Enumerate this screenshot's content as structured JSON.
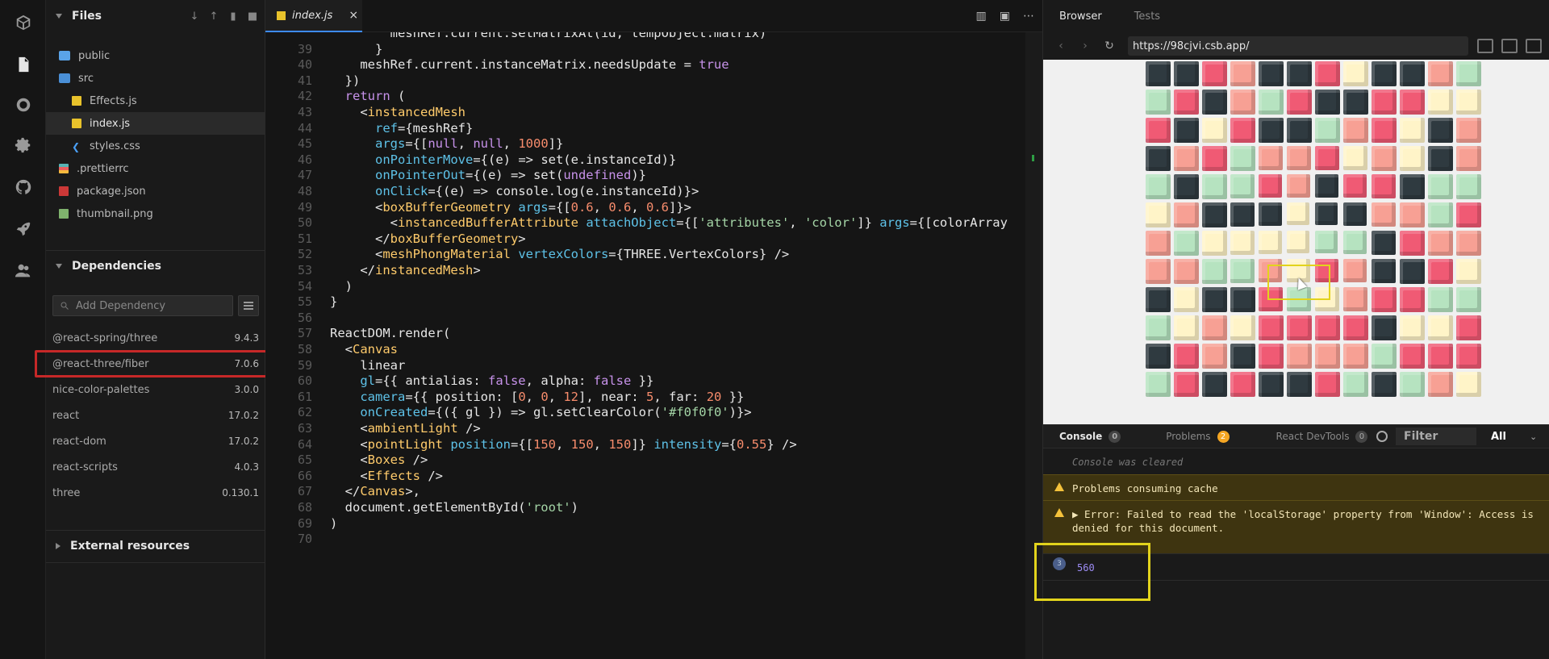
{
  "sidebar": {
    "files_title": "Files",
    "files": [
      {
        "name": "public",
        "type": "folder"
      },
      {
        "name": "src",
        "type": "folder-open"
      },
      {
        "name": "Effects.js",
        "type": "js"
      },
      {
        "name": "index.js",
        "type": "js",
        "active": true
      },
      {
        "name": "styles.css",
        "type": "css"
      },
      {
        "name": ".prettierrc",
        "type": "prettier"
      },
      {
        "name": "package.json",
        "type": "pkg"
      },
      {
        "name": "thumbnail.png",
        "type": "img"
      }
    ],
    "deps_title": "Dependencies",
    "dep_placeholder": "Add Dependency",
    "deps": [
      {
        "name": "@react-spring/three",
        "version": "9.4.3"
      },
      {
        "name": "@react-three/fiber",
        "version": "7.0.6"
      },
      {
        "name": "nice-color-palettes",
        "version": "3.0.0"
      },
      {
        "name": "react",
        "version": "17.0.2"
      },
      {
        "name": "react-dom",
        "version": "17.0.2"
      },
      {
        "name": "react-scripts",
        "version": "4.0.3"
      },
      {
        "name": "three",
        "version": "0.130.1"
      }
    ],
    "external_title": "External resources"
  },
  "editor": {
    "tab_label": "index.js",
    "close_glyph": "×",
    "lines": [
      {
        "n": "",
        "t": "        meshRef.current.setMatrixAt(id, tempObject.matrix)"
      },
      {
        "n": "39",
        "t": "      }"
      },
      {
        "n": "40",
        "t": "    meshRef.current.instanceMatrix.needsUpdate = true"
      },
      {
        "n": "41",
        "t": "  })"
      },
      {
        "n": "42",
        "t": "  return ("
      },
      {
        "n": "43",
        "t": "    <instancedMesh"
      },
      {
        "n": "44",
        "t": "      ref={meshRef}"
      },
      {
        "n": "45",
        "t": "      args={[null, null, 1000]}"
      },
      {
        "n": "46",
        "t": "      onPointerMove={(e) => set(e.instanceId)}"
      },
      {
        "n": "47",
        "t": "      onPointerOut={(e) => set(undefined)}"
      },
      {
        "n": "48",
        "t": "      onClick={(e) => console.log(e.instanceId)}>"
      },
      {
        "n": "49",
        "t": "      <boxBufferGeometry args={[0.6, 0.6, 0.6]}>"
      },
      {
        "n": "50",
        "t": "        <instancedBufferAttribute attachObject={['attributes', 'color']} args={[colorArray"
      },
      {
        "n": "51",
        "t": "      </boxBufferGeometry>"
      },
      {
        "n": "52",
        "t": "      <meshPhongMaterial vertexColors={THREE.VertexColors} />"
      },
      {
        "n": "53",
        "t": "    </instancedMesh>"
      },
      {
        "n": "54",
        "t": "  )"
      },
      {
        "n": "55",
        "t": "}"
      },
      {
        "n": "56",
        "t": ""
      },
      {
        "n": "57",
        "t": "ReactDOM.render("
      },
      {
        "n": "58",
        "t": "  <Canvas"
      },
      {
        "n": "59",
        "t": "    linear"
      },
      {
        "n": "60",
        "t": "    gl={{ antialias: false, alpha: false }}"
      },
      {
        "n": "61",
        "t": "    camera={{ position: [0, 0, 12], near: 5, far: 20 }}"
      },
      {
        "n": "62",
        "t": "    onCreated={({ gl }) => gl.setClearColor('#f0f0f0')}>"
      },
      {
        "n": "63",
        "t": "    <ambientLight />"
      },
      {
        "n": "64",
        "t": "    <pointLight position={[150, 150, 150]} intensity={0.55} />"
      },
      {
        "n": "65",
        "t": "    <Boxes />"
      },
      {
        "n": "66",
        "t": "    <Effects />"
      },
      {
        "n": "67",
        "t": "  </Canvas>,"
      },
      {
        "n": "68",
        "t": "  document.getElementById('root')"
      },
      {
        "n": "69",
        "t": ")"
      },
      {
        "n": "70",
        "t": ""
      }
    ]
  },
  "preview": {
    "tab_browser": "Browser",
    "tab_tests": "Tests",
    "url": "https://98cjvi.csb.app/",
    "palette": [
      "#f05a74",
      "#f7a094",
      "#2f3a40",
      "#b6e3c0",
      "#fff4c8"
    ]
  },
  "console": {
    "tab_console": "Console",
    "console_count": "0",
    "tab_problems": "Problems",
    "problems_count": "2",
    "tab_devtools": "React DevTools",
    "devtools_count": "0",
    "filter_label": "Filter",
    "all_label": "All",
    "cleared": "Console was cleared",
    "warn1": "Problems consuming cache",
    "warn2": "▶ Error: Failed to read the 'localStorage' property from 'Window': Access is denied for this document.",
    "log_badge": "3",
    "log_value": "560"
  }
}
